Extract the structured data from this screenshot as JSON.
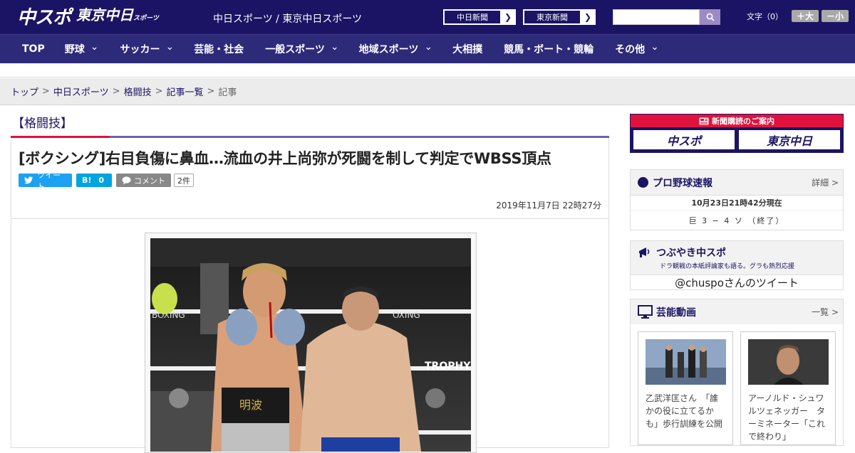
{
  "header": {
    "logo_main": "中スポ",
    "logo_tokyo": "東京中日",
    "logo_tokyo_sub": "スポーツ",
    "site_name": "中日スポーツ / 東京中日スポーツ",
    "paper_buttons": [
      {
        "label": "中日新聞"
      },
      {
        "label": "東京新聞"
      }
    ],
    "search_placeholder": "",
    "font_size_label": "文字（0）",
    "font_up": "＋大",
    "font_down": "－小"
  },
  "nav": {
    "items": [
      {
        "label": "TOP",
        "dropdown": false
      },
      {
        "label": "野球",
        "dropdown": true
      },
      {
        "label": "サッカー",
        "dropdown": true
      },
      {
        "label": "芸能・社会",
        "dropdown": false
      },
      {
        "label": "一般スポーツ",
        "dropdown": true
      },
      {
        "label": "地域スポーツ",
        "dropdown": true
      },
      {
        "label": "大相撲",
        "dropdown": false
      },
      {
        "label": "競馬・ボート・競輪",
        "dropdown": false
      },
      {
        "label": "その他",
        "dropdown": true
      }
    ]
  },
  "breadcrumb": {
    "items": [
      "トップ",
      "中日スポーツ",
      "格闘技",
      "記事一覧",
      "記事"
    ],
    "separator": ">"
  },
  "article": {
    "category": "【格闘技】",
    "headline": "[ボクシング]右目負傷に鼻血…流血の井上尚弥が死闘を制して判定でWBSS頂点",
    "tweet_label": "ツイート",
    "hatena_label": "B!",
    "hatena_count": "0",
    "comment_label": "コメント",
    "comment_count": "2件",
    "date": "2019年11月7日 22時27分",
    "photo_ring_text_left": "BOXING",
    "photo_ring_text_right": "OXING",
    "photo_trophy": "TROPHY",
    "photo_trunks": "明波"
  },
  "sidebar": {
    "subscribe": {
      "title": "新聞購読のご案内",
      "logo1": "中スポ",
      "logo2": "東京中日"
    },
    "baseball": {
      "title": "プロ野球速報",
      "more": "詳細 >",
      "status": "10月23日21時42分現在",
      "score": "巨 3 − 4 ソ （終了）"
    },
    "tsubuyaki": {
      "title": "つぶやき中スポ",
      "subtitle": "ドラ観戦の本紙評論家も語る。グラも熱烈応援",
      "link": "@chuspoさんのツイート"
    },
    "videos": {
      "title": "芸能動画",
      "more": "一覧 >",
      "items": [
        {
          "caption": "乙武洋匡さん　「誰かの役に立てるかも」歩行訓練を公開"
        },
        {
          "caption": "アーノルド・シュワルツェネッガー　ターミネーター「これで終わり」"
        }
      ]
    }
  },
  "colors": {
    "brand_navy": "#1b1464",
    "nav_bg": "#2e2a7a",
    "accent_red": "#e0123d",
    "accent_purple": "#6f62a8",
    "twitter": "#1da1f2",
    "hatena": "#00a4de"
  }
}
